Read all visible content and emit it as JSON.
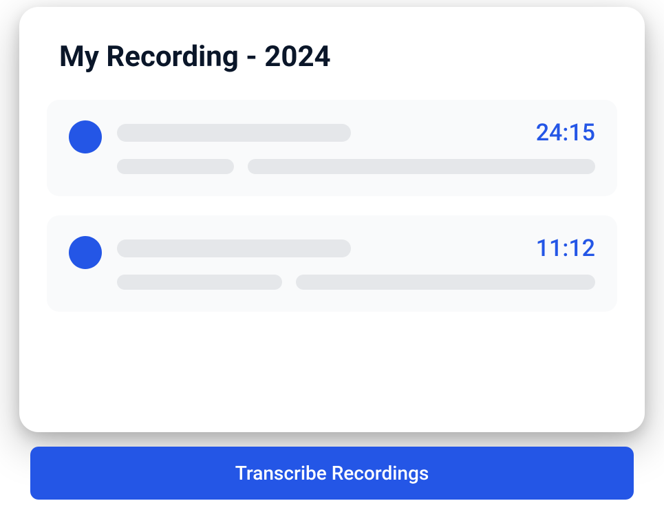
{
  "title": "My Recording - 2024",
  "recordings": [
    {
      "duration": "24:15"
    },
    {
      "duration": "11:12"
    }
  ],
  "action": {
    "transcribe_label": "Transcribe Recordings"
  },
  "colors": {
    "accent": "#2456e6"
  }
}
